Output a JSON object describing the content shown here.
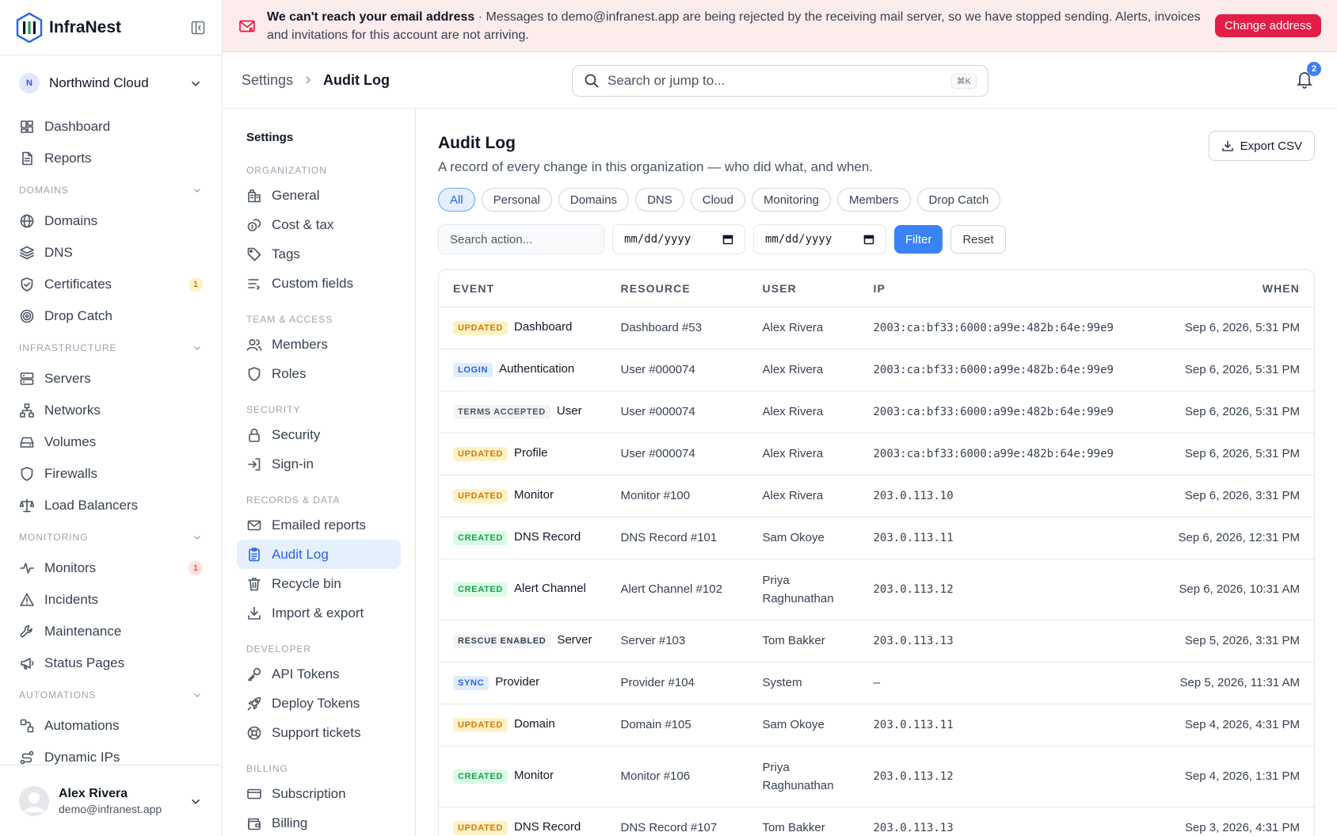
{
  "brand": {
    "name": "InfraNest"
  },
  "org": {
    "initial": "N",
    "name": "Northwind Cloud"
  },
  "sidebar": {
    "top": [
      {
        "label": "Dashboard",
        "icon": "dashboard-icon"
      },
      {
        "label": "Reports",
        "icon": "reports-icon"
      }
    ],
    "sections": [
      {
        "title": "DOMAINS",
        "items": [
          {
            "label": "Domains",
            "icon": "globe-icon"
          },
          {
            "label": "DNS",
            "icon": "layers-icon"
          },
          {
            "label": "Certificates",
            "icon": "shield-check-icon",
            "badge": "1",
            "badge_type": "warn"
          },
          {
            "label": "Drop Catch",
            "icon": "target-icon"
          }
        ]
      },
      {
        "title": "INFRASTRUCTURE",
        "items": [
          {
            "label": "Servers",
            "icon": "server-icon"
          },
          {
            "label": "Networks",
            "icon": "network-icon"
          },
          {
            "label": "Volumes",
            "icon": "drive-icon"
          },
          {
            "label": "Firewalls",
            "icon": "shield-icon"
          },
          {
            "label": "Load Balancers",
            "icon": "scale-icon"
          }
        ]
      },
      {
        "title": "MONITORING",
        "items": [
          {
            "label": "Monitors",
            "icon": "activity-icon",
            "badge": "1",
            "badge_type": "danger"
          },
          {
            "label": "Incidents",
            "icon": "alert-icon"
          },
          {
            "label": "Maintenance",
            "icon": "wrench-icon"
          },
          {
            "label": "Status Pages",
            "icon": "megaphone-icon"
          }
        ]
      },
      {
        "title": "AUTOMATIONS",
        "items": [
          {
            "label": "Automations",
            "icon": "workflow-icon"
          },
          {
            "label": "Dynamic IPs",
            "icon": "route-icon"
          }
        ]
      }
    ]
  },
  "user": {
    "name": "Alex Rivera",
    "email": "demo@infranest.app"
  },
  "banner": {
    "title": "We can't reach your email address",
    "separator": " · ",
    "message": "Messages to demo@infranest.app are being rejected by the receiving mail server, so we have stopped sending. Alerts, invoices and invitations for this account are not arriving.",
    "button": "Change address"
  },
  "header": {
    "crumb_parent": "Settings",
    "crumb_current": "Audit Log",
    "search_placeholder": "Search or jump to...",
    "search_shortcut": "⌘K",
    "notifications_count": "2"
  },
  "subnav": {
    "title": "Settings",
    "sections": [
      {
        "title": "ORGANIZATION",
        "items": [
          {
            "label": "General",
            "icon": "building-icon"
          },
          {
            "label": "Cost & tax",
            "icon": "coins-icon"
          },
          {
            "label": "Tags",
            "icon": "tag-icon"
          },
          {
            "label": "Custom fields",
            "icon": "list-icon"
          }
        ]
      },
      {
        "title": "TEAM & ACCESS",
        "items": [
          {
            "label": "Members",
            "icon": "users-icon"
          },
          {
            "label": "Roles",
            "icon": "shield-icon"
          }
        ]
      },
      {
        "title": "SECURITY",
        "items": [
          {
            "label": "Security",
            "icon": "lock-icon"
          },
          {
            "label": "Sign-in",
            "icon": "sign-in-icon"
          }
        ]
      },
      {
        "title": "RECORDS & DATA",
        "items": [
          {
            "label": "Emailed reports",
            "icon": "mail-icon"
          },
          {
            "label": "Audit Log",
            "icon": "clipboard-icon",
            "active": true
          },
          {
            "label": "Recycle bin",
            "icon": "trash-icon"
          },
          {
            "label": "Import & export",
            "icon": "download-icon"
          }
        ]
      },
      {
        "title": "DEVELOPER",
        "items": [
          {
            "label": "API Tokens",
            "icon": "key-icon"
          },
          {
            "label": "Deploy Tokens",
            "icon": "rocket-icon"
          },
          {
            "label": "Support tickets",
            "icon": "lifebuoy-icon"
          }
        ]
      },
      {
        "title": "BILLING",
        "items": [
          {
            "label": "Subscription",
            "icon": "card-icon"
          },
          {
            "label": "Billing",
            "icon": "wallet-icon"
          }
        ]
      }
    ]
  },
  "main": {
    "title": "Audit Log",
    "subtitle": "A record of every change in this organization — who did what, and when.",
    "export_label": "Export CSV",
    "chips": [
      "All",
      "Personal",
      "Domains",
      "DNS",
      "Cloud",
      "Monitoring",
      "Members",
      "Drop Catch"
    ],
    "active_chip": "All",
    "search_placeholder": "Search action...",
    "date_from": "mm/dd/yyyy",
    "date_to": "mm/dd/yyyy",
    "filter_label": "Filter",
    "reset_label": "Reset",
    "columns": [
      "EVENT",
      "RESOURCE",
      "USER",
      "IP",
      "WHEN"
    ],
    "rows": [
      {
        "tag": "UPDATED",
        "tag_type": "updated",
        "event": "Dashboard",
        "resource": "Dashboard #53",
        "user": "Alex Rivera",
        "ip": "2003:ca:bf33:6000:a99e:482b:64e:99e9",
        "when": "Sep 6, 2026, 5:31 PM"
      },
      {
        "tag": "LOGIN",
        "tag_type": "login",
        "event": "Authentication",
        "resource": "User #000074",
        "user": "Alex Rivera",
        "ip": "2003:ca:bf33:6000:a99e:482b:64e:99e9",
        "when": "Sep 6, 2026, 5:31 PM"
      },
      {
        "tag": "TERMS ACCEPTED",
        "tag_type": "terms",
        "event": "User",
        "resource": "User #000074",
        "user": "Alex Rivera",
        "ip": "2003:ca:bf33:6000:a99e:482b:64e:99e9",
        "when": "Sep 6, 2026, 5:31 PM"
      },
      {
        "tag": "UPDATED",
        "tag_type": "updated",
        "event": "Profile",
        "resource": "User #000074",
        "user": "Alex Rivera",
        "ip": "2003:ca:bf33:6000:a99e:482b:64e:99e9",
        "when": "Sep 6, 2026, 5:31 PM"
      },
      {
        "tag": "UPDATED",
        "tag_type": "updated",
        "event": "Monitor",
        "resource": "Monitor #100",
        "user": "Alex Rivera",
        "ip": "203.0.113.10",
        "when": "Sep 6, 2026, 3:31 PM"
      },
      {
        "tag": "CREATED",
        "tag_type": "created",
        "event": "DNS Record",
        "resource": "DNS Record #101",
        "user": "Sam Okoye",
        "ip": "203.0.113.11",
        "when": "Sep 6, 2026, 12:31 PM"
      },
      {
        "tag": "CREATED",
        "tag_type": "created",
        "event": "Alert Channel",
        "resource": "Alert Channel #102",
        "user": "Priya Raghunathan",
        "ip": "203.0.113.12",
        "when": "Sep 6, 2026, 10:31 AM",
        "tall": true
      },
      {
        "tag": "RESCUE ENABLED",
        "tag_type": "rescue",
        "event": "Server",
        "resource": "Server #103",
        "user": "Tom Bakker",
        "ip": "203.0.113.13",
        "when": "Sep 5, 2026, 3:31 PM"
      },
      {
        "tag": "SYNC",
        "tag_type": "sync",
        "event": "Provider",
        "resource": "Provider #104",
        "user": "System",
        "ip": "–",
        "when": "Sep 5, 2026, 11:31 AM"
      },
      {
        "tag": "UPDATED",
        "tag_type": "updated",
        "event": "Domain",
        "resource": "Domain #105",
        "user": "Sam Okoye",
        "ip": "203.0.113.11",
        "when": "Sep 4, 2026, 4:31 PM"
      },
      {
        "tag": "CREATED",
        "tag_type": "created",
        "event": "Monitor",
        "resource": "Monitor #106",
        "user": "Priya Raghunathan",
        "ip": "203.0.113.12",
        "when": "Sep 4, 2026, 1:31 PM",
        "tall": true
      },
      {
        "tag": "UPDATED",
        "tag_type": "updated",
        "event": "DNS Record",
        "resource": "DNS Record #107",
        "user": "Tom Bakker",
        "ip": "203.0.113.13",
        "when": "Sep 3, 2026, 4:31 PM"
      }
    ]
  }
}
